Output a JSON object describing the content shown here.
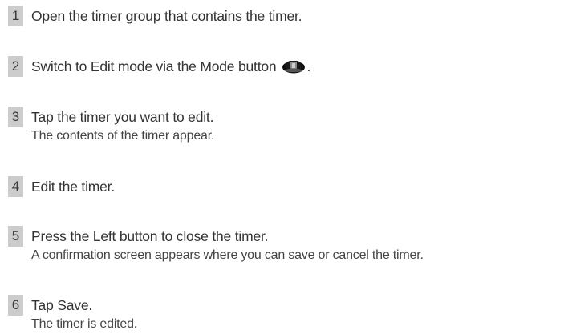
{
  "steps": [
    {
      "number": "1",
      "title": "Open the timer group that contains the timer."
    },
    {
      "number": "2",
      "title": "Switch to Edit mode via the Mode button",
      "title_end": ".",
      "icon": "mode-button-icon"
    },
    {
      "number": "3",
      "title": "Tap the timer you want to edit.",
      "detail": "The contents of the timer appear."
    },
    {
      "number": "4",
      "title": "Edit the timer."
    },
    {
      "number": "5",
      "title": "Press the Left button to close the timer.",
      "detail": "A confirmation screen appears where you can save or cancel the timer."
    },
    {
      "number": "6",
      "title": "Tap Save.",
      "detail": "The timer is edited."
    }
  ],
  "colors": {
    "number_badge": "#cccccc",
    "text": "#333333"
  }
}
